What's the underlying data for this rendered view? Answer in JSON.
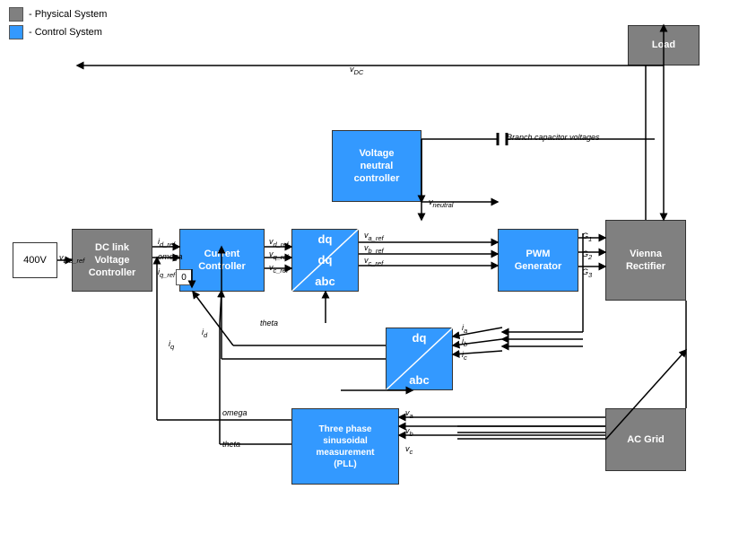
{
  "legend": {
    "physical_label": "- Physical System",
    "control_label": "- Control  System"
  },
  "blocks": {
    "v400": {
      "label": "400V",
      "type": "white"
    },
    "dc_link": {
      "label": "DC link\nVoltage\nController",
      "type": "gray"
    },
    "current_ctrl": {
      "label": "Current\nController",
      "type": "blue"
    },
    "dq_abc_top": {
      "label": "dq\n\nabc",
      "type": "blue"
    },
    "voltage_neutral": {
      "label": "Voltage\nneutral\ncontroller",
      "type": "blue"
    },
    "pwm_gen": {
      "label": "PWM\nGenerator",
      "type": "blue"
    },
    "vienna": {
      "label": "Vienna\nRectifier",
      "type": "gray"
    },
    "load": {
      "label": "Load",
      "type": "gray"
    },
    "dq_abc_mid": {
      "label": "dq\n\nabc",
      "type": "blue"
    },
    "three_phase": {
      "label": "Three phase\nsinusoidal\nmeasurement\n(PLL)",
      "type": "blue"
    },
    "ac_grid": {
      "label": "AC Grid",
      "type": "gray"
    }
  },
  "signals": {
    "vdc_ref": "v_DC_ref",
    "vdc": "v_DC",
    "id_ref": "i_d_ref",
    "omega": "omega",
    "iq_ref": "i_q_ref",
    "vd_ref": "v_d_ref",
    "vq_ref": "v_q_ref",
    "vc_ref": "v_c_ref",
    "va_ref": "v_a_ref",
    "vb_ref": "v_b_ref",
    "vcref2": "v_c_ref",
    "theta": "theta",
    "iq": "i_q",
    "id": "i_d",
    "ia": "i_a",
    "ib": "i_b",
    "ic": "i_c",
    "va": "v_a",
    "vb": "v_b",
    "vc": "v_c",
    "vneutral": "v_neutral",
    "branch_cap": "Branch capacitor voltages",
    "g1": "G₁",
    "g2": "G₂",
    "g3": "G₃"
  }
}
